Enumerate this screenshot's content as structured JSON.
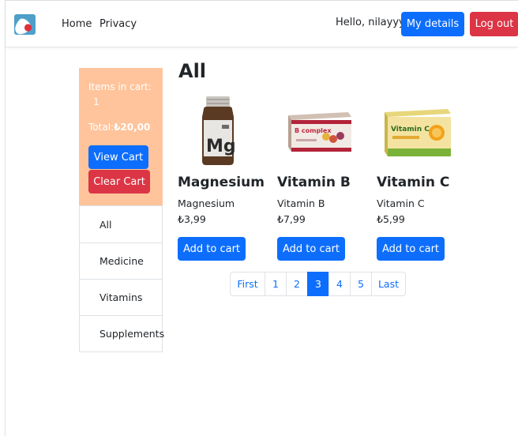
{
  "nav": {
    "brand_icon": "pill-icon",
    "links": [
      "Home",
      "Privacy"
    ],
    "greeting": "Hello, nilayyy",
    "my_details_label": "My details",
    "logout_label": "Log out"
  },
  "cart": {
    "items_label": "Items in cart:",
    "items_count": "1",
    "total_label": "Total:",
    "total_value": "₺20,00",
    "view_cart_label": "View Cart",
    "clear_cart_label": "Clear Cart"
  },
  "categories": [
    "All",
    "Medicine",
    "Vitamins",
    "Supplements"
  ],
  "main": {
    "title": "All",
    "products": [
      {
        "name": "Magnesium",
        "description": "Magnesium",
        "price": "₺3,99",
        "button": "Add to cart",
        "image": "magnesium-bottle-image",
        "label_text": "Mg"
      },
      {
        "name": "Vitamin B",
        "description": "Vitamin B",
        "price": "₺7,99",
        "button": "Add to cart",
        "image": "vitamin-b-box-image",
        "label_text": "B complex"
      },
      {
        "name": "Vitamin C",
        "description": "Vitamin C",
        "price": "₺5,99",
        "button": "Add to cart",
        "image": "vitamin-c-box-image",
        "label_text": "Vitamin C"
      }
    ]
  },
  "pagination": {
    "items": [
      "First",
      "1",
      "2",
      "3",
      "4",
      "5",
      "Last"
    ],
    "active": "3"
  },
  "colors": {
    "primary": "#0d6efd",
    "danger": "#dc3545",
    "cart_background": "#ffc49b",
    "brand_background": "#4f9fc9"
  }
}
